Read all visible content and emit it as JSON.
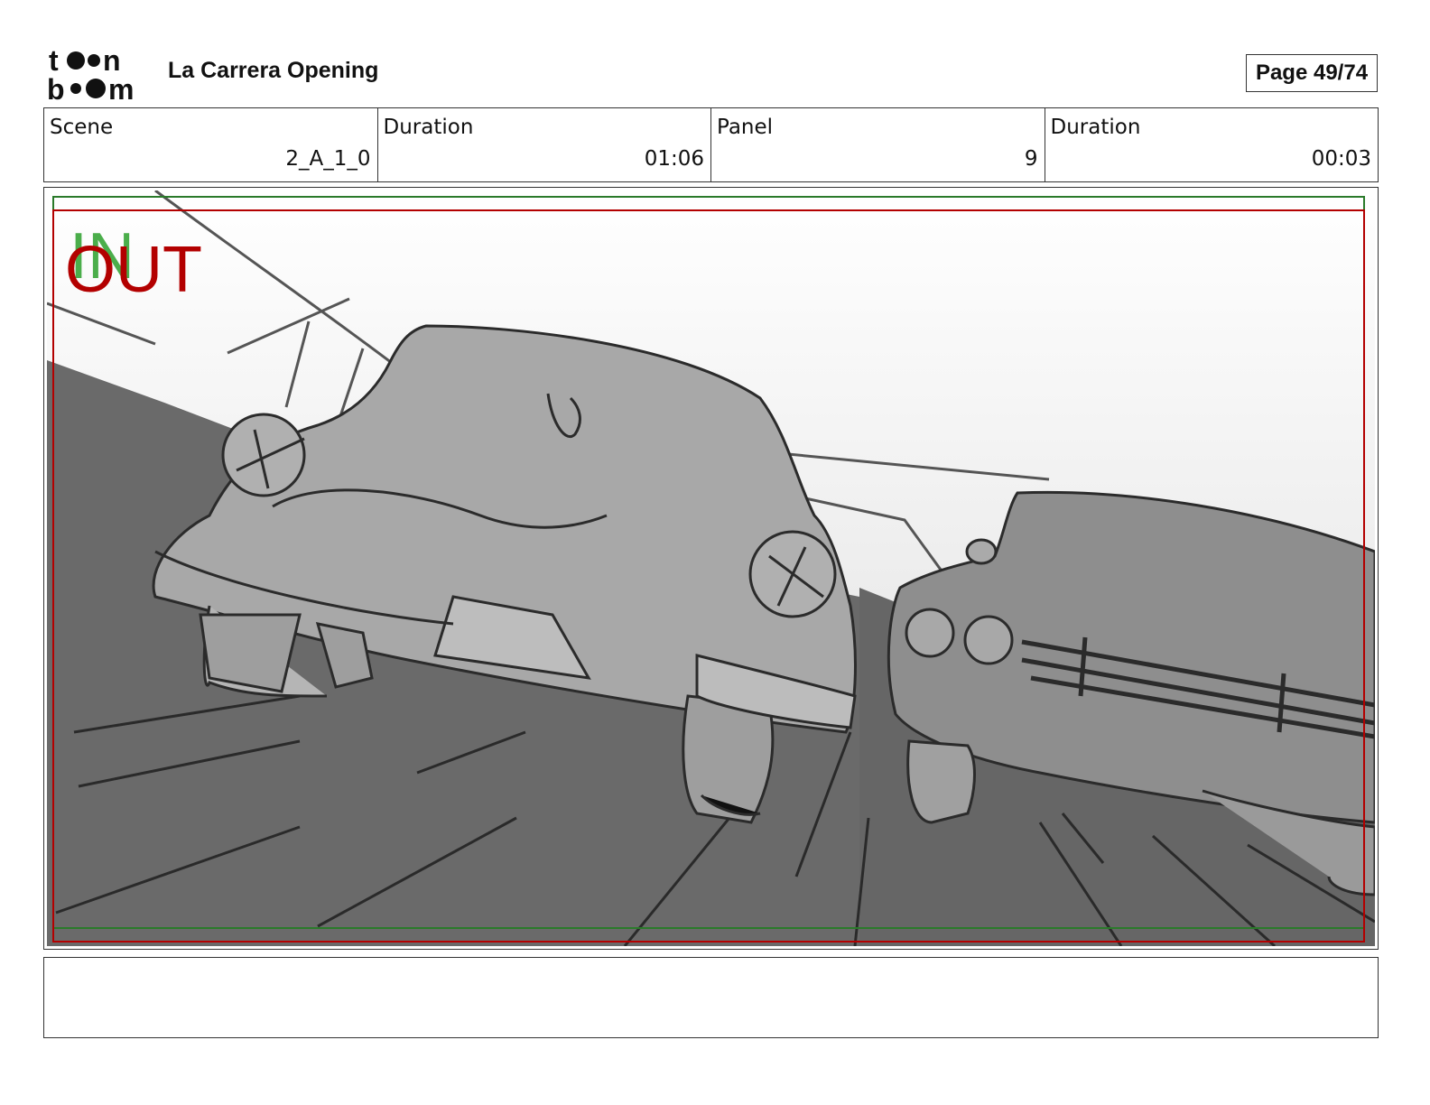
{
  "header": {
    "logo": {
      "line1": "toon",
      "line2": "boom",
      "icon": "toon-boom-logo"
    },
    "project_title": "La Carrera Opening",
    "page_label": "Page 49/74"
  },
  "info_table": [
    {
      "label": "Scene",
      "value": "2_A_1_0"
    },
    {
      "label": "Duration",
      "value": "01:06"
    },
    {
      "label": "Panel",
      "value": "9"
    },
    {
      "label": "Duration",
      "value": "00:03"
    }
  ],
  "panel": {
    "in_marker": "IN",
    "out_marker": "OUT",
    "in_color": "#2ca02c",
    "out_color": "#b30000"
  },
  "notes": {
    "text": ""
  }
}
